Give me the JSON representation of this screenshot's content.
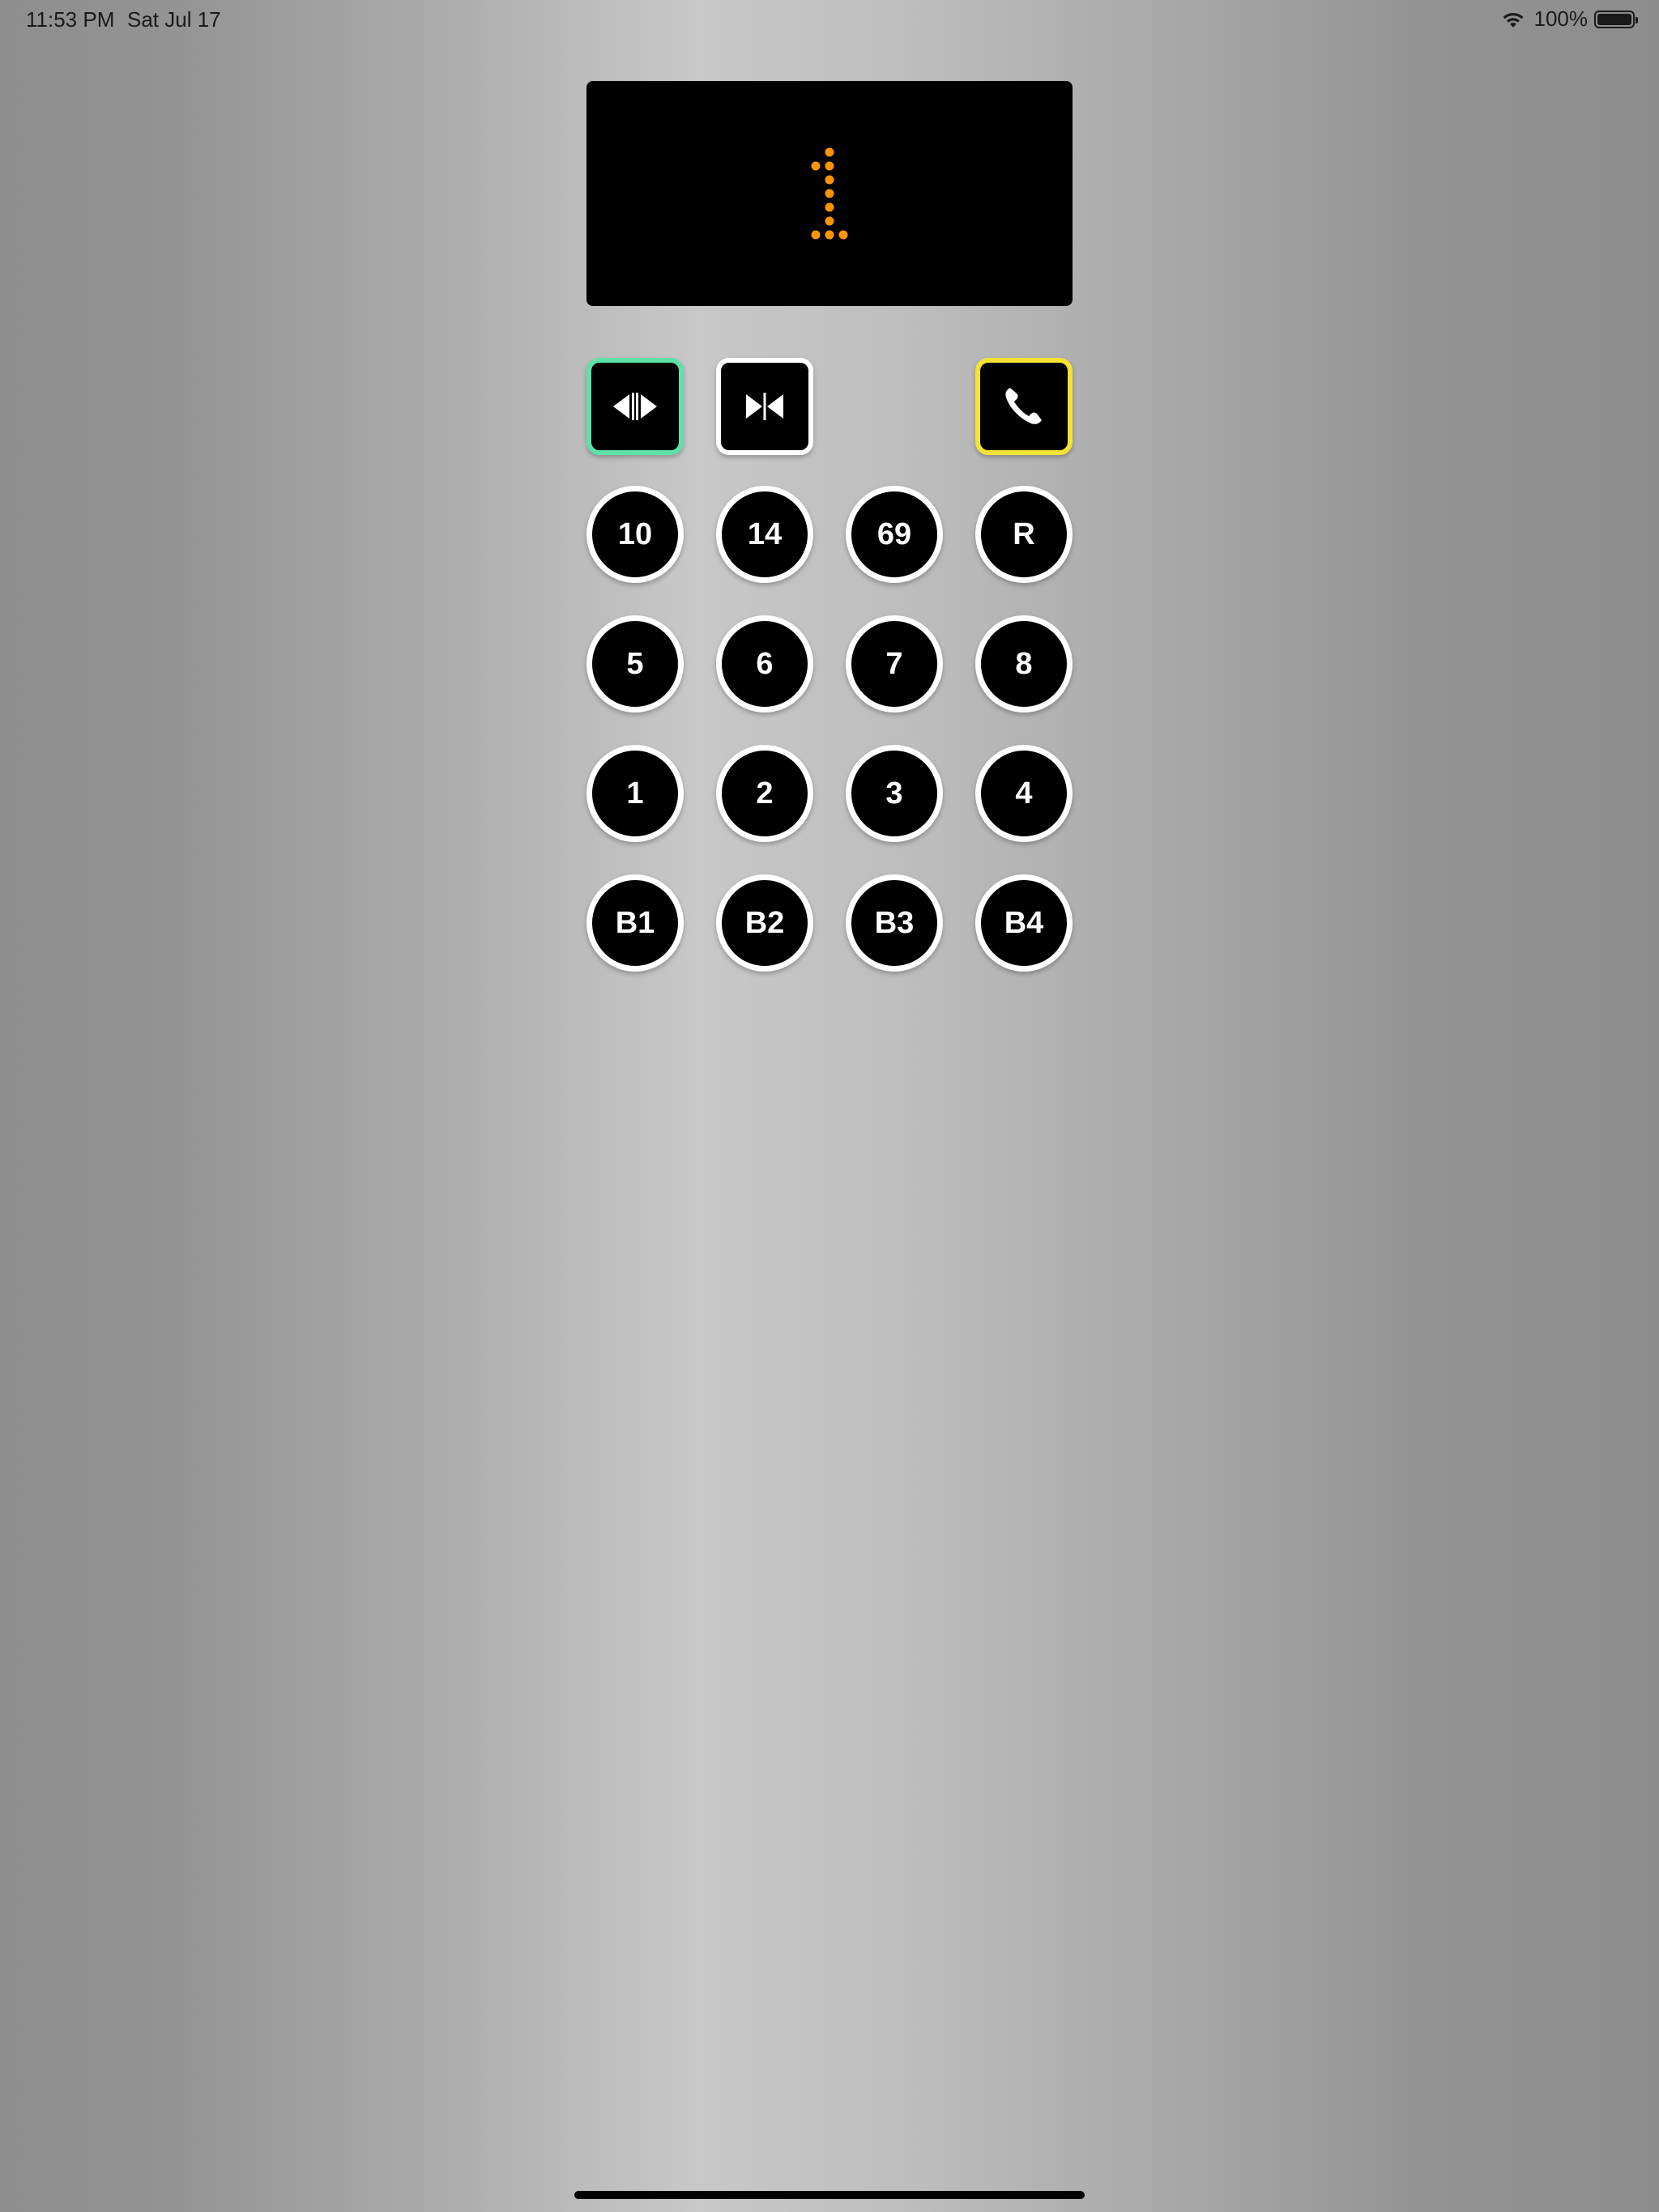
{
  "status_bar": {
    "time": "11:53 PM",
    "date": "Sat Jul 17",
    "battery_percent": "100%",
    "icons": [
      "wifi-icon",
      "battery-icon"
    ]
  },
  "floor_display": {
    "current_floor": "1",
    "led_color": "#ff9500"
  },
  "controls": {
    "door_open": {
      "icon": "door-open-icon",
      "border_color": "#5fe0a8"
    },
    "door_close": {
      "icon": "door-close-icon",
      "border_color": "#ffffff"
    },
    "emergency_call": {
      "icon": "phone-icon",
      "border_color": "#f4e235"
    }
  },
  "floor_buttons": [
    [
      "10",
      "14",
      "69",
      "R"
    ],
    [
      "5",
      "6",
      "7",
      "8"
    ],
    [
      "1",
      "2",
      "3",
      "4"
    ],
    [
      "B1",
      "B2",
      "B3",
      "B4"
    ]
  ]
}
